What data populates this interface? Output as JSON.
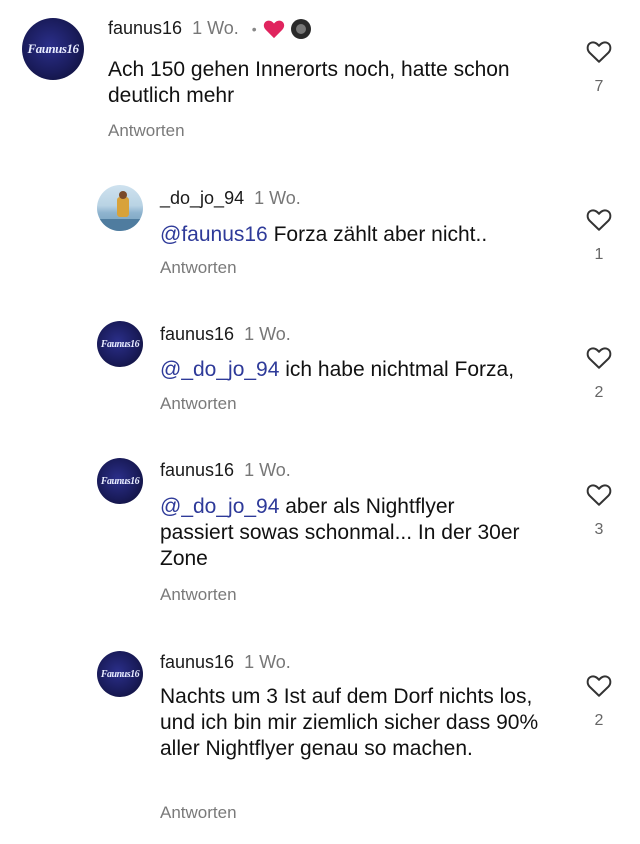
{
  "comments": [
    {
      "username": "faunus16",
      "time": "1 Wo.",
      "text_pre": "",
      "mention": "",
      "text": "Ach 150 gehen Innerorts noch, hatte schon deutlich mehr",
      "reply_label": "Antworten",
      "likes": "7",
      "avatar_label": "Faunus16",
      "author_badges": true
    },
    {
      "username": "_do_jo_94",
      "time": "1 Wo.",
      "mention": "@faunus16",
      "text": " Forza zählt aber nicht..",
      "reply_label": "Antworten",
      "likes": "1"
    },
    {
      "username": "faunus16",
      "time": "1 Wo.",
      "mention": "@_do_jo_94",
      "text": " ich habe nichtmal Forza,",
      "reply_label": "Antworten",
      "likes": "2",
      "avatar_label": "Faunus16"
    },
    {
      "username": "faunus16",
      "time": "1 Wo.",
      "mention": "@_do_jo_94",
      "text": " aber als Nightflyer passiert sowas schonmal... In der 30er Zone",
      "reply_label": "Antworten",
      "likes": "3",
      "avatar_label": "Faunus16"
    },
    {
      "username": "faunus16",
      "time": "1 Wo.",
      "mention": "",
      "text": "Nachts um 3 Ist auf dem Dorf nichts los, und ich bin mir ziemlich sicher dass 90% aller Nightflyer genau so machen.",
      "reply_label": "Antworten",
      "likes": "2",
      "avatar_label": "Faunus16"
    }
  ],
  "colors": {
    "mention": "#2e3a99",
    "heart_badge": "#e0245e",
    "meta": "#777777"
  }
}
